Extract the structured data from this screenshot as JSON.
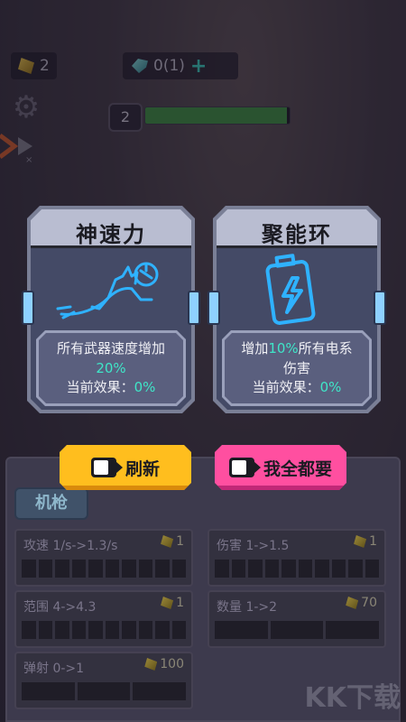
{
  "hud": {
    "gold": "2",
    "crystals": "0(1)",
    "level": "2",
    "level_progress": 0.98
  },
  "cards": [
    {
      "title": "神速力",
      "icon": "cat-sprint-icon",
      "desc_line1": "所有武器速度增加",
      "desc_value": "20%",
      "effect_label": "当前效果：",
      "effect_value": "0%"
    },
    {
      "title": "聚能环",
      "icon": "battery-lightning-icon",
      "desc_prefix": "增加",
      "desc_value": "10%",
      "desc_suffix": "所有电系",
      "desc_line2": "伤害",
      "effect_label": "当前效果：",
      "effect_value": "0%"
    }
  ],
  "buttons": {
    "refresh": "刷新",
    "take_all": "我全都要"
  },
  "weapon_tab": "机枪",
  "stats": [
    {
      "label": "攻速 1/s->1.3/s",
      "cost": "1"
    },
    {
      "label": "伤害 1->1.5",
      "cost": "1"
    },
    {
      "label": "范围 4->4.3",
      "cost": "1"
    },
    {
      "label": "数量 1->2",
      "cost": "70"
    },
    {
      "label": "弹射 0->1",
      "cost": "100"
    }
  ],
  "watermark": "KK下载",
  "colors": {
    "accent_teal": "#3fe6c8",
    "refresh_yellow": "#ffbe1e",
    "take_all_pink": "#ff4fa0",
    "neon_blue": "#2fb2ff"
  }
}
